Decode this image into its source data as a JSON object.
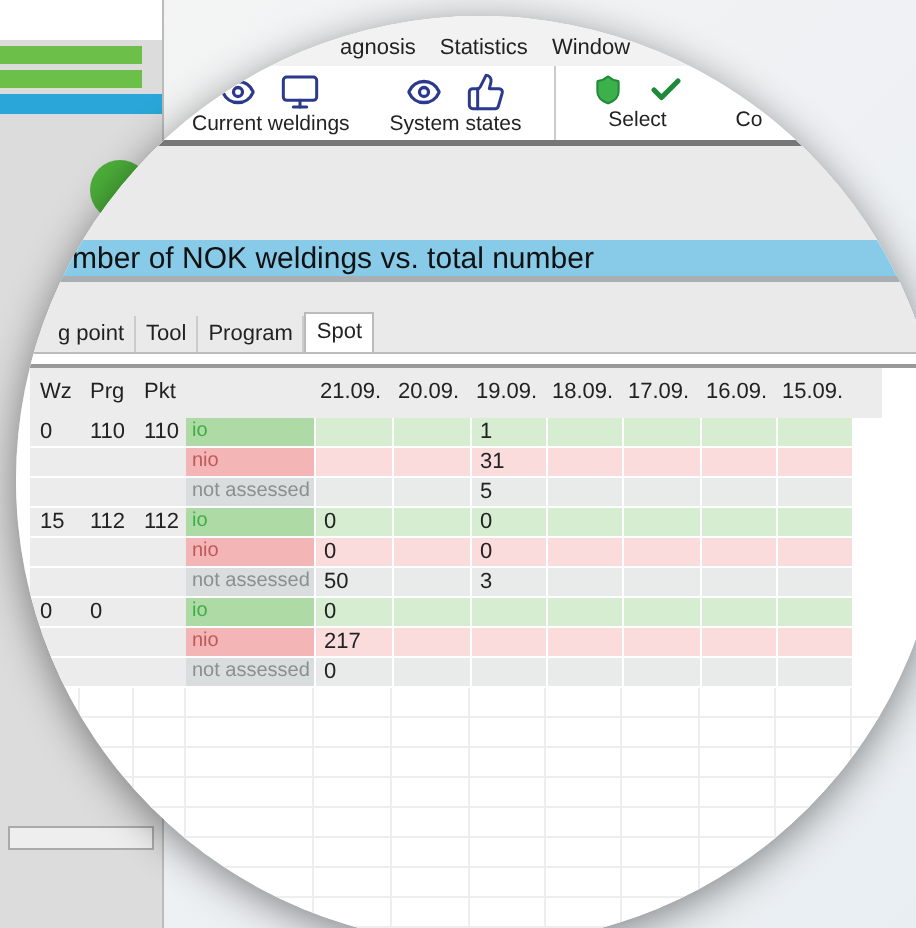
{
  "menu": [
    "agnosis",
    "Statistics",
    "Window"
  ],
  "toolbar": [
    {
      "label": "Current weldings",
      "kind": "weldings"
    },
    {
      "label": "System states",
      "kind": "states"
    },
    {
      "label": "Select",
      "kind": "select"
    },
    {
      "label": "Co",
      "kind": "partial"
    }
  ],
  "title": "mber of NOK weldings vs. total number",
  "tabs": [
    {
      "label": "g point",
      "selected": false
    },
    {
      "label": "Tool",
      "selected": false
    },
    {
      "label": "Program",
      "selected": false
    },
    {
      "label": "Spot",
      "selected": true
    }
  ],
  "table": {
    "key_columns": [
      "Wz",
      "Prg",
      "Pkt"
    ],
    "dates": [
      "21.09.",
      "20.09.",
      "19.09.",
      "18.09.",
      "17.09.",
      "16.09.",
      "15.09."
    ],
    "groups": [
      {
        "keys": [
          "0",
          "110",
          "110"
        ],
        "rows": [
          {
            "kind": "io",
            "status": "io",
            "cells": [
              {
                "kind": "empty"
              },
              {
                "kind": "empty"
              },
              {
                "kind": "number",
                "value": "1"
              },
              {
                "kind": "empty"
              },
              {
                "kind": "empty"
              },
              {
                "kind": "empty"
              },
              {
                "kind": "empty"
              }
            ]
          },
          {
            "kind": "nio",
            "status": "nio",
            "cells": [
              {
                "kind": "empty"
              },
              {
                "kind": "empty"
              },
              {
                "kind": "number",
                "value": "31"
              },
              {
                "kind": "empty"
              },
              {
                "kind": "empty"
              },
              {
                "kind": "empty"
              },
              {
                "kind": "empty"
              }
            ]
          },
          {
            "kind": "na",
            "status": "not assessed",
            "cells": [
              {
                "kind": "empty"
              },
              {
                "kind": "empty"
              },
              {
                "kind": "number",
                "value": "5"
              },
              {
                "kind": "empty"
              },
              {
                "kind": "empty"
              },
              {
                "kind": "empty"
              },
              {
                "kind": "empty"
              }
            ]
          }
        ]
      },
      {
        "keys": [
          "15",
          "112",
          "112"
        ],
        "rows": [
          {
            "kind": "io",
            "status": "io",
            "cells": [
              {
                "kind": "number",
                "value": "0"
              },
              {
                "kind": "empty"
              },
              {
                "kind": "number",
                "value": "0"
              },
              {
                "kind": "empty"
              },
              {
                "kind": "empty"
              },
              {
                "kind": "empty"
              },
              {
                "kind": "empty"
              }
            ]
          },
          {
            "kind": "nio",
            "status": "nio",
            "cells": [
              {
                "kind": "number",
                "value": "0"
              },
              {
                "kind": "empty"
              },
              {
                "kind": "number",
                "value": "0"
              },
              {
                "kind": "empty"
              },
              {
                "kind": "empty"
              },
              {
                "kind": "empty"
              },
              {
                "kind": "empty"
              }
            ]
          },
          {
            "kind": "na",
            "status": "not assessed",
            "cells": [
              {
                "kind": "number",
                "value": "50"
              },
              {
                "kind": "empty"
              },
              {
                "kind": "number",
                "value": "3"
              },
              {
                "kind": "empty"
              },
              {
                "kind": "empty"
              },
              {
                "kind": "empty"
              },
              {
                "kind": "empty"
              }
            ]
          }
        ]
      },
      {
        "keys": [
          "0",
          "0"
        ],
        "rows": [
          {
            "kind": "io",
            "status": "io",
            "cells": [
              {
                "kind": "number",
                "value": "0"
              },
              {
                "kind": "empty"
              },
              {
                "kind": "empty"
              },
              {
                "kind": "empty"
              },
              {
                "kind": "empty"
              },
              {
                "kind": "empty"
              },
              {
                "kind": "empty"
              }
            ]
          },
          {
            "kind": "nio",
            "status": "nio",
            "cells": [
              {
                "kind": "number",
                "value": "217"
              },
              {
                "kind": "empty"
              },
              {
                "kind": "empty"
              },
              {
                "kind": "empty"
              },
              {
                "kind": "empty"
              },
              {
                "kind": "empty"
              },
              {
                "kind": "empty"
              }
            ]
          },
          {
            "kind": "na",
            "status": "not assessed",
            "cells": [
              {
                "kind": "number",
                "value": "0"
              },
              {
                "kind": "empty"
              },
              {
                "kind": "empty"
              },
              {
                "kind": "empty"
              },
              {
                "kind": "empty"
              },
              {
                "kind": "empty"
              },
              {
                "kind": "empty"
              }
            ]
          }
        ]
      }
    ]
  }
}
